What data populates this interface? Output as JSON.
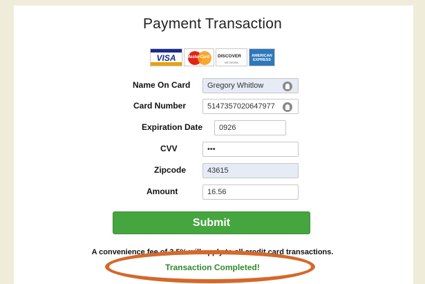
{
  "page": {
    "title": "Payment Transaction",
    "background_color": "#efedd9",
    "accent_color": "#45a53f",
    "highlight_color": "#d4692a"
  },
  "cards": {
    "visa": "VISA",
    "mastercard": "MasterCard",
    "discover": "DISCOVER",
    "discover_sub": "NETWORK",
    "amex": "AMERICAN EXPRESS"
  },
  "form": {
    "name_label": "Name On Card",
    "name_value": "Gregory Whitlow",
    "card_label": "Card Number",
    "card_value": "5147357020647977",
    "exp_label": "Expiration Date",
    "exp_value": "0926",
    "cvv_label": "CVV",
    "cvv_value": "•••",
    "zip_label": "Zipcode",
    "zip_value": "43615",
    "amount_label": "Amount",
    "amount_value": "16.56"
  },
  "submit_label": "Submit",
  "fee_notice": "A convenience fee of 3.5% will apply to all credit card transactions.",
  "status": "Transaction Completed!"
}
